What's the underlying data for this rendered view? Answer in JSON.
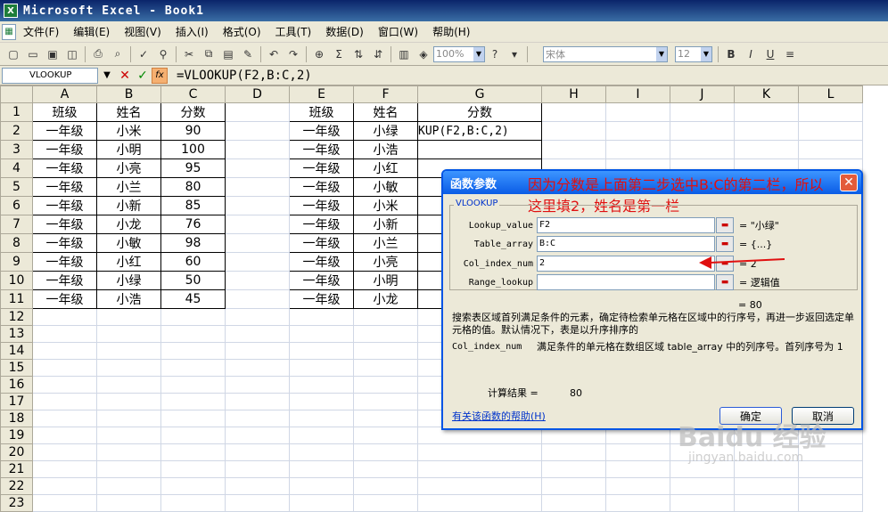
{
  "window": {
    "title": "Microsoft Excel - Book1",
    "icon": "excel-icon"
  },
  "menu": [
    "文件(F)",
    "编辑(E)",
    "视图(V)",
    "插入(I)",
    "格式(O)",
    "工具(T)",
    "数据(D)",
    "窗口(W)",
    "帮助(H)"
  ],
  "toolbar": {
    "zoom": "100%",
    "font": "宋体",
    "font_size": "12",
    "bold": "B",
    "italic": "I",
    "underline": "U"
  },
  "formula_bar": {
    "name_box": "VLOOKUP",
    "cancel": "✕",
    "enter": "✓",
    "fx": "fx",
    "formula": "=VLOOKUP(F2,B:C,2)"
  },
  "columns": [
    "A",
    "B",
    "C",
    "D",
    "E",
    "F",
    "G",
    "H",
    "I",
    "J",
    "K",
    "L"
  ],
  "rows": [
    "1",
    "2",
    "3",
    "4",
    "5",
    "6",
    "7",
    "8",
    "9",
    "10",
    "11",
    "12",
    "13",
    "14",
    "15",
    "16",
    "17",
    "18",
    "19",
    "20",
    "21",
    "22",
    "23"
  ],
  "table1": {
    "headers": [
      "班级",
      "姓名",
      "分数"
    ],
    "rows": [
      [
        "一年级",
        "小米",
        "90"
      ],
      [
        "一年级",
        "小明",
        "100"
      ],
      [
        "一年级",
        "小亮",
        "95"
      ],
      [
        "一年级",
        "小兰",
        "80"
      ],
      [
        "一年级",
        "小新",
        "85"
      ],
      [
        "一年级",
        "小龙",
        "76"
      ],
      [
        "一年级",
        "小敏",
        "98"
      ],
      [
        "一年级",
        "小红",
        "60"
      ],
      [
        "一年级",
        "小绿",
        "50"
      ],
      [
        "一年级",
        "小浩",
        "45"
      ]
    ]
  },
  "table2": {
    "headers": [
      "班级",
      "姓名",
      "分数"
    ],
    "rows": [
      [
        "一年级",
        "小绿"
      ],
      [
        "一年级",
        "小浩"
      ],
      [
        "一年级",
        "小红"
      ],
      [
        "一年级",
        "小敏"
      ],
      [
        "一年级",
        "小米"
      ],
      [
        "一年级",
        "小新"
      ],
      [
        "一年级",
        "小兰"
      ],
      [
        "一年级",
        "小亮"
      ],
      [
        "一年级",
        "小明"
      ],
      [
        "一年级",
        "小龙"
      ]
    ],
    "g2": "KUP(F2,B:C,2)"
  },
  "dialog": {
    "title": "函数参数",
    "annotation_line1": "因为分数是上面第二步选中B:C的第二栏，所以",
    "annotation_line2": "这里填2，姓名是第一栏",
    "group": "VLOOKUP",
    "args": [
      {
        "label": "Lookup_value",
        "value": "F2",
        "result": "= \"小绿\""
      },
      {
        "label": "Table_array",
        "value": "B:C",
        "result": "= {...}"
      },
      {
        "label": "Col_index_num",
        "value": "2",
        "result": "= 2"
      },
      {
        "label": "Range_lookup",
        "value": "",
        "result": "= 逻辑值"
      }
    ],
    "total": "= 80",
    "description": "搜索表区域首列满足条件的元素，确定待检索单元格在区域中的行序号，再进一步返回选定单元格的值。默认情况下，表是以升序排序的",
    "param_name": "Col_index_num",
    "param_desc": "满足条件的单元格在数组区域 table_array 中的列序号。首列序号为 1",
    "result_label": "计算结果 =",
    "result_value": "80",
    "help_link": "有关该函数的帮助(H)",
    "ok": "确定",
    "cancel": "取消"
  },
  "watermark": {
    "text": "Baidu 经验",
    "url": "jingyan.baidu.com"
  }
}
